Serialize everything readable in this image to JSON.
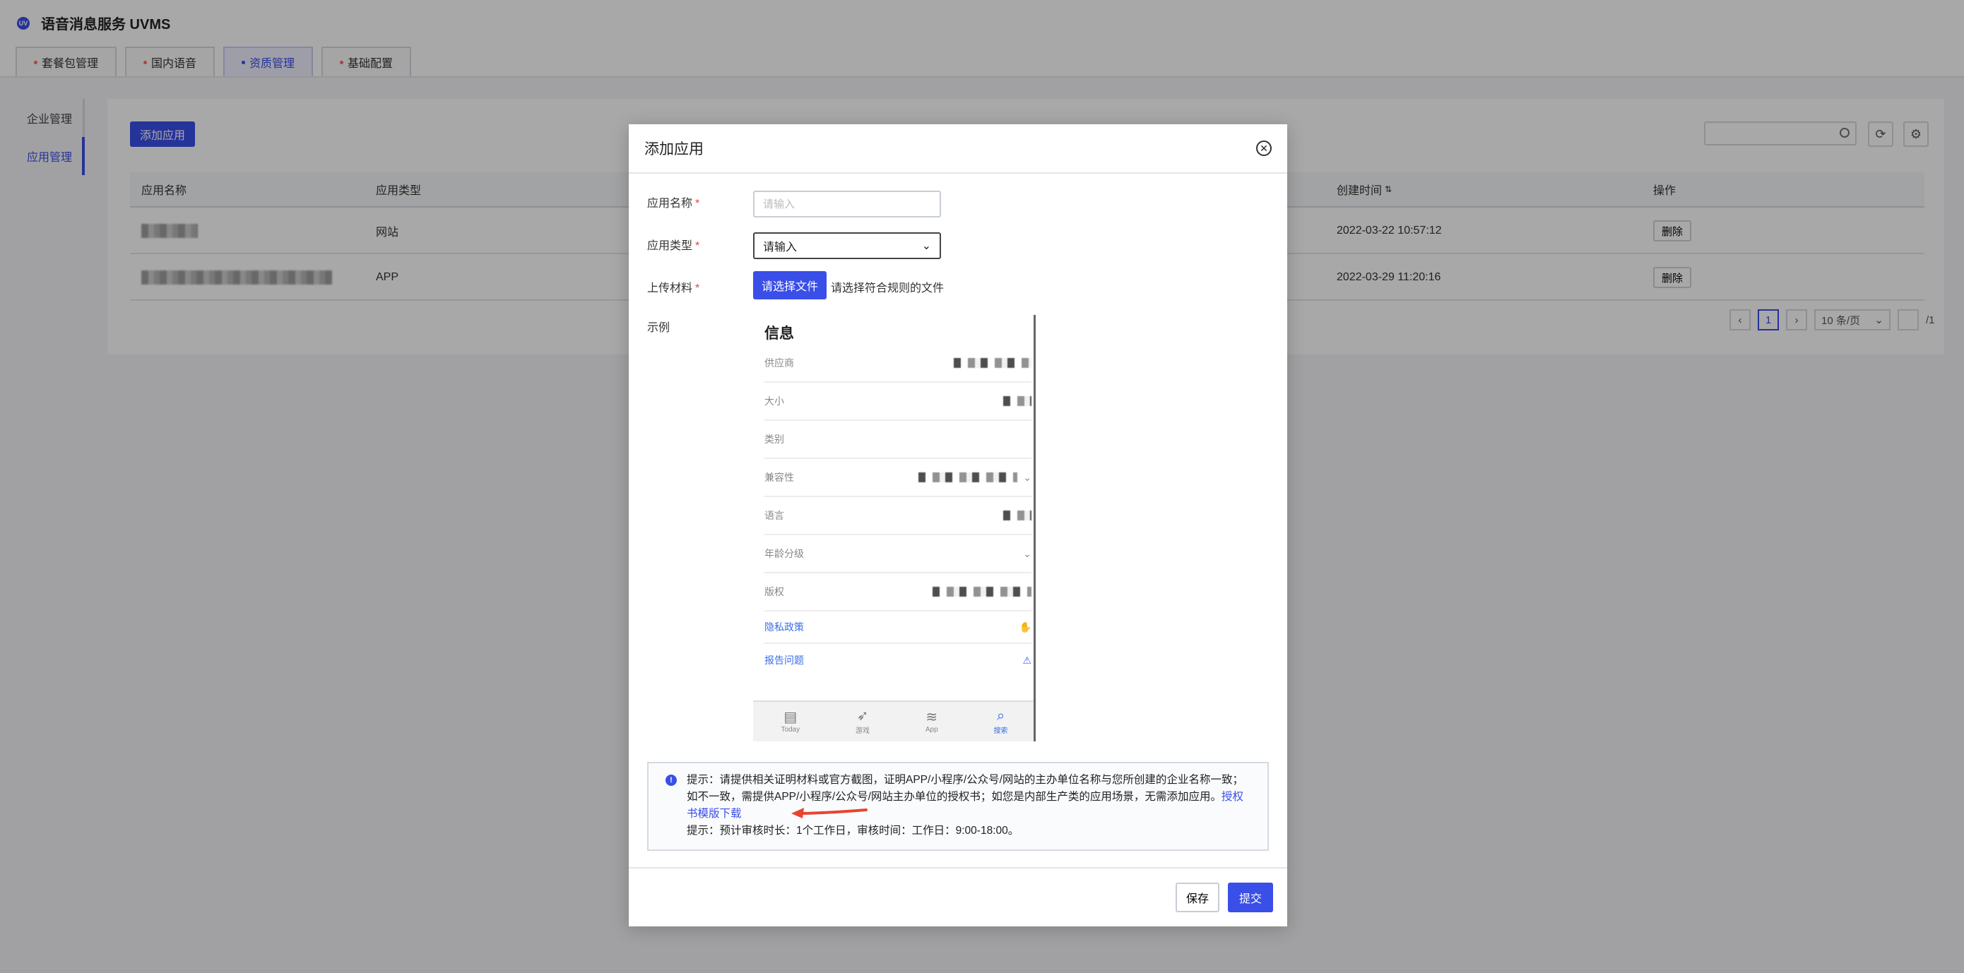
{
  "app": {
    "logo": "UV",
    "title": "语音消息服务 UVMS"
  },
  "tabs": [
    {
      "label": "套餐包管理",
      "active": false
    },
    {
      "label": "国内语音",
      "active": false
    },
    {
      "label": "资质管理",
      "active": true
    },
    {
      "label": "基础配置",
      "active": false
    }
  ],
  "sidebar": {
    "items": [
      {
        "label": "企业管理",
        "active": false
      },
      {
        "label": "应用管理",
        "active": true
      }
    ]
  },
  "toolbar": {
    "add_app": "添加应用",
    "search_placeholder": ""
  },
  "table": {
    "columns": [
      "应用名称",
      "应用类型",
      "创建时间",
      "操作"
    ],
    "sort_icon": "sort-icon",
    "rows": [
      {
        "name": "",
        "type": "网站",
        "created": "2022-03-22 10:57:12",
        "action": "删除"
      },
      {
        "name": "",
        "type": "APP",
        "created": "2022-03-29 11:20:16",
        "action": "删除"
      }
    ]
  },
  "pagination": {
    "current": "1",
    "page_size": "10 条/页",
    "total_pages": "/1"
  },
  "modal": {
    "title": "添加应用",
    "fields": {
      "app_name_label": "应用名称",
      "app_name_placeholder": "请输入",
      "app_type_label": "应用类型",
      "app_type_value": "请输入",
      "upload_label": "上传材料",
      "upload_button": "请选择文件",
      "upload_hint": "请选择符合规则的文件",
      "required_mark": "*",
      "example_label": "示例"
    },
    "example": {
      "title": "信息",
      "rows": [
        "供应商",
        "大小",
        "类别",
        "兼容性",
        "语言",
        "年龄分级",
        "版权"
      ],
      "links": [
        "隐私政策",
        "报告问题"
      ],
      "tabbar": [
        "Today",
        "游戏",
        "App",
        "搜索"
      ]
    },
    "notice": {
      "line1": "提示：请提供相关证明材料或官方截图，证明APP/小程序/公众号/网站的主办单位名称与您所创建的企业名称一致；如不一致，需提供APP/小程序/公众号/网站主办单位的授权书；如您是内部生产类的应用场景，无需添加应用。",
      "download_link": "授权书模版下载",
      "line2": "提示：预计审核时长：1个工作日，审核时间：工作日：9:00-18:00。"
    },
    "footer": {
      "save": "保存",
      "submit": "提交"
    }
  },
  "colors": {
    "primary": "#3a4ee8",
    "required": "#e54545",
    "arrow": "#e8442f",
    "overlay": "rgba(0,0,0,0.34)"
  }
}
